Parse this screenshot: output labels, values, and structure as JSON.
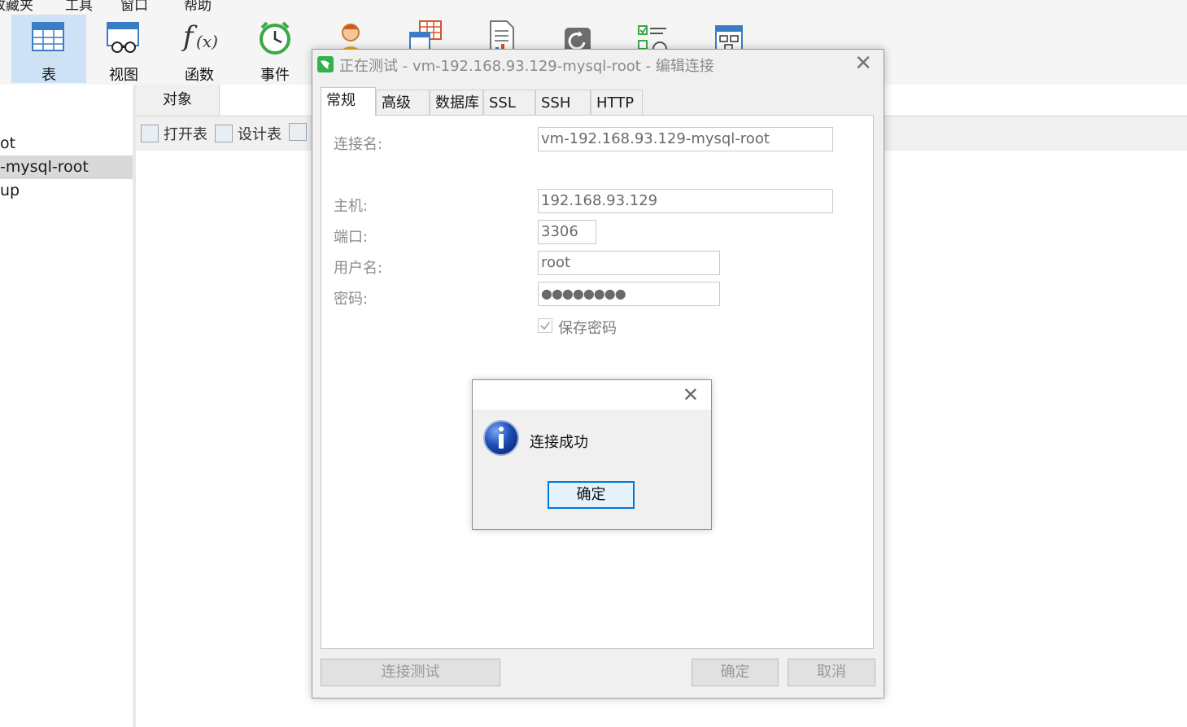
{
  "menu": {
    "items": [
      {
        "label": "收藏夹"
      },
      {
        "label": "工具"
      },
      {
        "label": "窗口"
      },
      {
        "label": "帮助"
      }
    ]
  },
  "toolbar": {
    "buttons": [
      {
        "label": "表",
        "icon": "table-icon",
        "active": true
      },
      {
        "label": "视图",
        "icon": "view-icon"
      },
      {
        "label": "函数",
        "icon": "function-icon"
      },
      {
        "label": "事件",
        "icon": "event-clock-icon"
      },
      {
        "label": "",
        "icon": "user-icon"
      },
      {
        "label": "",
        "icon": "query-icon"
      },
      {
        "label": "",
        "icon": "report-icon"
      },
      {
        "label": "",
        "icon": "backup-icon"
      },
      {
        "label": "",
        "icon": "schedule-icon"
      },
      {
        "label": "",
        "icon": "model-icon"
      }
    ]
  },
  "tree": {
    "items": [
      {
        "label": "ot"
      },
      {
        "label": "-mysql-root",
        "selected": true
      },
      {
        "label": "up"
      }
    ]
  },
  "objects": {
    "tab_label": "对象",
    "tools": [
      {
        "label": "打开表"
      },
      {
        "label": "设计表"
      },
      {
        "label": ""
      }
    ]
  },
  "dialog": {
    "title": "正在测试 - vm-192.168.93.129-mysql-root - 编辑连接",
    "tabs": [
      {
        "label": "常规",
        "active": true
      },
      {
        "label": "高级"
      },
      {
        "label": "数据库"
      },
      {
        "label": "SSL"
      },
      {
        "label": "SSH"
      },
      {
        "label": "HTTP"
      }
    ],
    "fields": {
      "connection_name_label": "连接名:",
      "connection_name_value": "vm-192.168.93.129-mysql-root",
      "host_label": "主机:",
      "host_value": "192.168.93.129",
      "port_label": "端口:",
      "port_value": "3306",
      "username_label": "用户名:",
      "username_value": "root",
      "password_label": "密码:",
      "password_value": "●●●●●●●●",
      "save_password_label": "保存密码",
      "save_password_checked": true
    },
    "buttons": {
      "test": "连接测试",
      "ok": "确定",
      "cancel": "取消"
    }
  },
  "message_box": {
    "text": "连接成功",
    "ok": "确定",
    "icon": "info-icon"
  },
  "colors": {
    "toolbar_active": "#cde3f5",
    "tree_selected": "#d9d9d9",
    "focus_border": "#0078d7",
    "info_blue": "#1f4fb8"
  }
}
